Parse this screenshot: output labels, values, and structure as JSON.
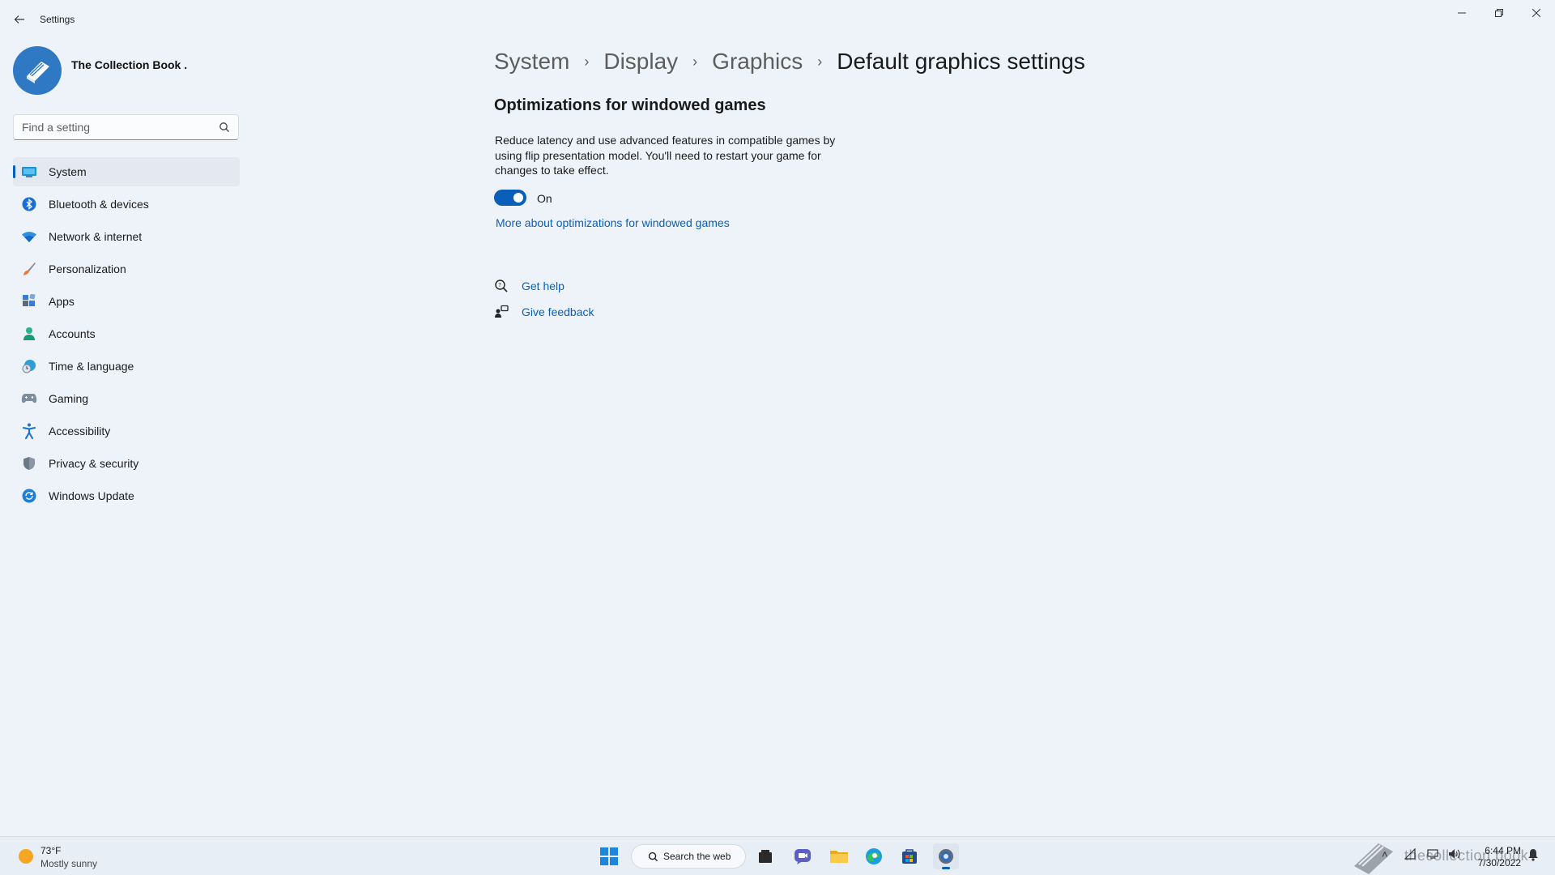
{
  "window": {
    "title": "Settings",
    "controls": {
      "minimize": "–",
      "maximize": "❐",
      "close": "✕"
    }
  },
  "profile": {
    "name": "The Collection Book ."
  },
  "search": {
    "placeholder": "Find a setting"
  },
  "nav": {
    "items": [
      {
        "label": "System",
        "icon": "system-icon",
        "active": true
      },
      {
        "label": "Bluetooth & devices",
        "icon": "bluetooth-icon"
      },
      {
        "label": "Network & internet",
        "icon": "wifi-icon"
      },
      {
        "label": "Personalization",
        "icon": "brush-icon"
      },
      {
        "label": "Apps",
        "icon": "apps-icon"
      },
      {
        "label": "Accounts",
        "icon": "person-icon"
      },
      {
        "label": "Time & language",
        "icon": "globe-clock-icon"
      },
      {
        "label": "Gaming",
        "icon": "gamepad-icon"
      },
      {
        "label": "Accessibility",
        "icon": "accessibility-icon"
      },
      {
        "label": "Privacy & security",
        "icon": "shield-icon"
      },
      {
        "label": "Windows Update",
        "icon": "update-icon"
      }
    ]
  },
  "breadcrumb": {
    "items": [
      "System",
      "Display",
      "Graphics",
      "Default graphics settings"
    ],
    "separator": "›"
  },
  "content": {
    "section_title": "Optimizations for windowed games",
    "description": "Reduce latency and use advanced features in compatible games by using flip presentation model. You'll need to restart your game for changes to take effect.",
    "toggle_state": "On",
    "toggle_on": true,
    "more_link": "More about optimizations for windowed games",
    "get_help": "Get help",
    "give_feedback": "Give feedback"
  },
  "taskbar": {
    "weather_temp": "73°F",
    "weather_condition": "Mostly sunny",
    "search_label": "Search the web",
    "watermark_text": "thecollection book",
    "time": "6:44 PM",
    "date": "7/30/2022"
  },
  "colors": {
    "accent": "#0a5fb8",
    "background": "#eef3fa"
  }
}
